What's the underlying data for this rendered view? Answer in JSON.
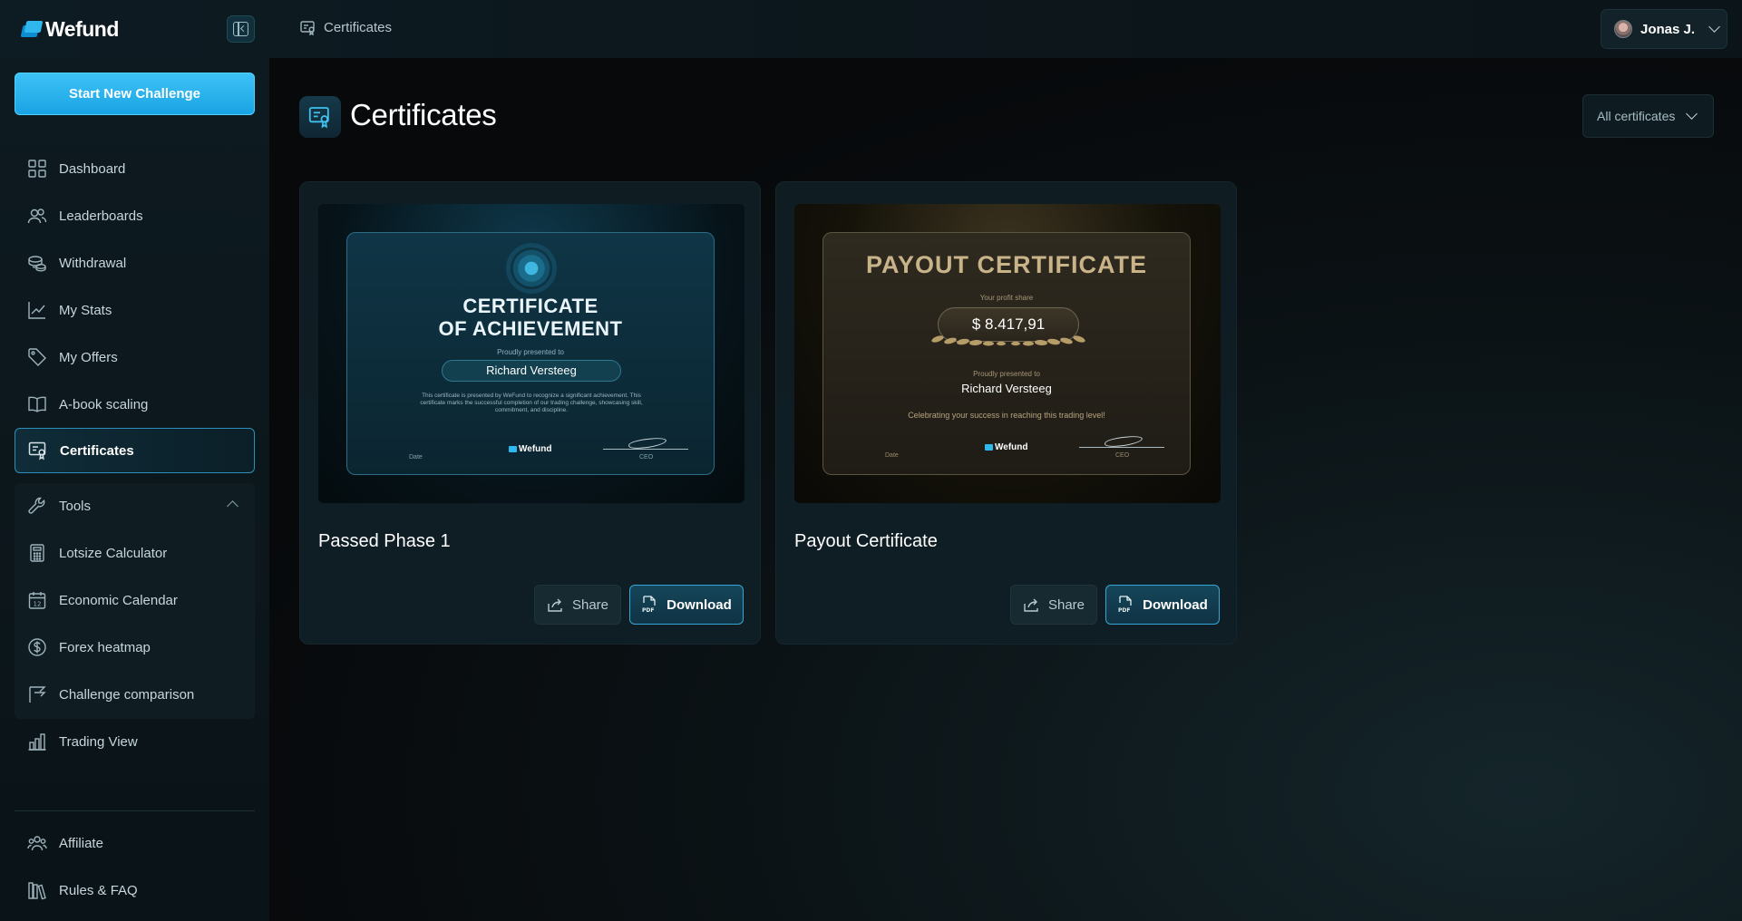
{
  "app": {
    "brand": "Wefund"
  },
  "header": {
    "breadcrumb": "Certificates",
    "user_name": "Jonas J."
  },
  "sidebar": {
    "cta_label": "Start New Challenge",
    "items": [
      {
        "label": "Dashboard",
        "icon": "grid-icon"
      },
      {
        "label": "Leaderboards",
        "icon": "users-icon"
      },
      {
        "label": "Withdrawal",
        "icon": "coins-icon"
      },
      {
        "label": "My Stats",
        "icon": "chart-line-icon"
      },
      {
        "label": "My Offers",
        "icon": "tag-icon"
      },
      {
        "label": "A-book scaling",
        "icon": "book-icon"
      },
      {
        "label": "Certificates",
        "icon": "certificate-icon",
        "active": true
      },
      {
        "label": "Tools",
        "icon": "wrench-icon",
        "expanded": true
      }
    ],
    "tools": [
      {
        "label": "Lotsize Calculator",
        "icon": "calculator-icon"
      },
      {
        "label": "Economic Calendar",
        "icon": "calendar-icon"
      },
      {
        "label": "Forex heatmap",
        "icon": "dollar-icon"
      },
      {
        "label": "Challenge comparison",
        "icon": "compare-icon"
      }
    ],
    "trading_view": {
      "label": "Trading View",
      "icon": "bars-icon"
    },
    "bottom": [
      {
        "label": "Affiliate",
        "icon": "affiliate-icon"
      },
      {
        "label": "Rules & FAQ",
        "icon": "books-icon"
      }
    ]
  },
  "main": {
    "title": "Certificates",
    "filter_value": "All certificates",
    "cards": [
      {
        "title": "Passed Phase 1",
        "share_label": "Share",
        "download_label": "Download",
        "certificate": {
          "heading_line1": "CERTIFICATE",
          "heading_line2": "OF ACHIEVEMENT",
          "presented_to": "Proudly presented to",
          "name": "Richard Versteeg",
          "body": "This certificate is presented by WeFund to recognize a significant achievement. This certificate marks the successful completion of our trading challenge, showcasing skill, commitment, and discipline.",
          "date_label": "Date",
          "ceo_label": "CEO",
          "logo": "Wefund"
        }
      },
      {
        "title": "Payout Certificate",
        "share_label": "Share",
        "download_label": "Download",
        "certificate": {
          "heading": "PAYOUT CERTIFICATE",
          "profit_label": "Your profit share",
          "amount": "$ 8.417,91",
          "presented_to": "Proudly presented to",
          "name": "Richard Versteeg",
          "message": "Celebrating your success in reaching this trading level!",
          "date_label": "Date",
          "ceo_label": "CEO",
          "logo": "Wefund"
        }
      }
    ]
  },
  "colors": {
    "accent": "#2fb8ee",
    "active_border": "#2c8fbb",
    "background": "#07090b",
    "gold_text": "#c9b48a"
  }
}
